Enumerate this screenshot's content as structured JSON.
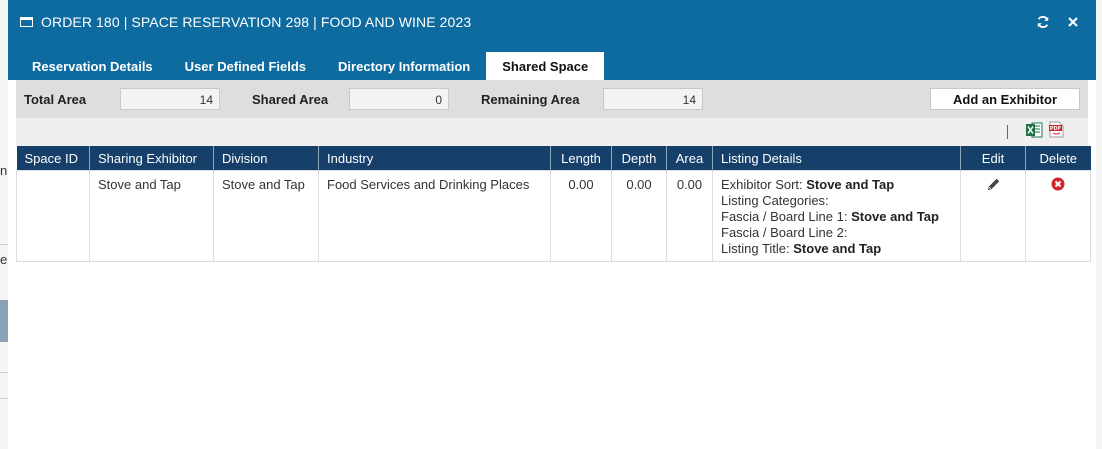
{
  "window": {
    "title": "ORDER 180 | SPACE RESERVATION 298 | FOOD AND WINE 2023",
    "icon": "window-icon",
    "refresh_icon": "refresh-icon",
    "close_icon": "close-icon"
  },
  "tabs": [
    {
      "label": "Reservation Details",
      "active": false
    },
    {
      "label": "User Defined Fields",
      "active": false
    },
    {
      "label": "Directory Information",
      "active": false
    },
    {
      "label": "Shared Space",
      "active": true
    }
  ],
  "summary": {
    "total_area_label": "Total Area",
    "total_area_value": "14",
    "shared_area_label": "Shared Area",
    "shared_area_value": "0",
    "remaining_area_label": "Remaining Area",
    "remaining_area_value": "14",
    "add_button": "Add an Exhibitor"
  },
  "toolbar": {
    "excel_icon": "excel-export-icon",
    "pdf_icon": "pdf-export-icon",
    "pdf_text": "PDF"
  },
  "table": {
    "columns": [
      "Space ID",
      "Sharing Exhibitor",
      "Division",
      "Industry",
      "Length",
      "Depth",
      "Area",
      "Listing Details",
      "Edit",
      "Delete"
    ],
    "rows": [
      {
        "space_id": "",
        "sharing_exhibitor": "Stove and Tap",
        "division": "Stove and Tap",
        "industry": "Food Services and Drinking Places",
        "length": "0.00",
        "depth": "0.00",
        "area": "0.00",
        "listing": {
          "sort_label": "Exhibitor Sort: ",
          "sort_value": "Stove and Tap",
          "categories_label": "Listing Categories:",
          "fascia1_label": "Fascia / Board Line 1: ",
          "fascia1_value": "Stove and Tap",
          "fascia2_label": "Fascia / Board Line 2:",
          "title_label": "Listing Title: ",
          "title_value": "Stove and Tap"
        },
        "edit_icon": "pencil-icon",
        "delete_icon": "delete-icon"
      }
    ]
  },
  "background": {
    "left_text_1": "n",
    "left_text_2": "e"
  },
  "colors": {
    "titlebar": "#0e6ba0",
    "table_header": "#163f6a",
    "delete": "#d2232a",
    "excel": "#1e7145"
  }
}
